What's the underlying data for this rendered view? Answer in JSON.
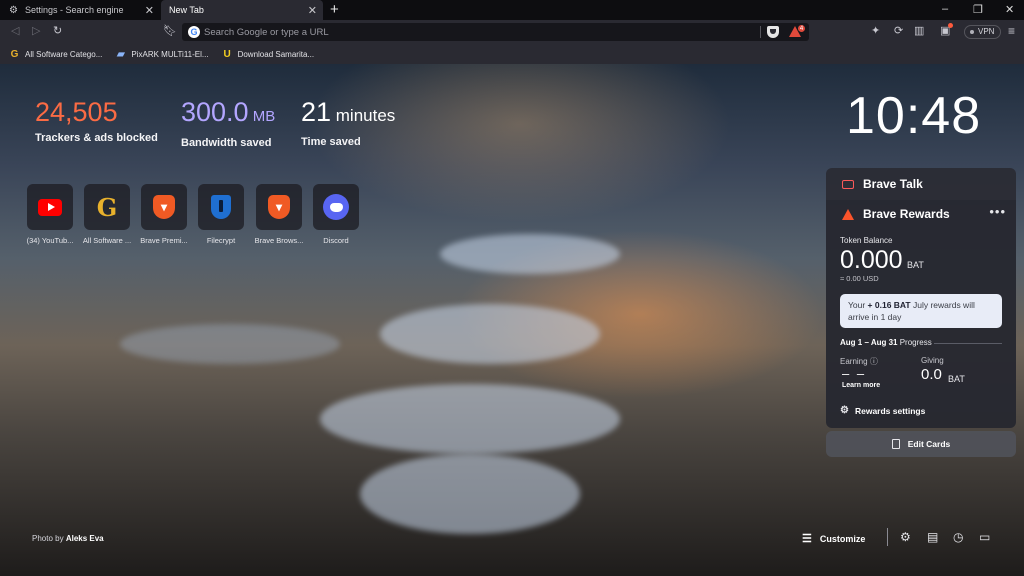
{
  "tabs": [
    {
      "title": "Settings - Search engine",
      "icon": "gear-icon"
    },
    {
      "title": "New Tab",
      "icon": "brave-icon"
    }
  ],
  "new_tab_symbol": "+",
  "window_controls": {
    "minimize": "–",
    "restore": "❐",
    "close": "✕"
  },
  "omnibox": {
    "placeholder": "Search Google or type a URL",
    "value": ""
  },
  "rewards_badge_count": "4",
  "vpn_label": "VPN",
  "bookmarks": [
    {
      "label": "All Software Catego...",
      "icon": "G",
      "color": "#e8b12c"
    },
    {
      "label": "PixARK MULTi11-El...",
      "icon": "▰",
      "color": "#8ab4f8"
    },
    {
      "label": "Download Samarita...",
      "icon": "U",
      "color": "#f5d020"
    }
  ],
  "stats": {
    "trackers": {
      "value": "24,505",
      "unit": "",
      "label": "Trackers & ads blocked",
      "color": "#fb6b44"
    },
    "bandwidth": {
      "value": "300.0",
      "unit": " MB",
      "label": "Bandwidth saved",
      "color": "#b3a6ff"
    },
    "time": {
      "value": "21",
      "unit": " minutes",
      "label": "Time saved",
      "color": "#ffffff"
    }
  },
  "clock": "10:48",
  "top_sites": [
    {
      "label": "(34) YouTub...",
      "icon": "youtube-icon"
    },
    {
      "label": "All Software ...",
      "icon": "g-icon"
    },
    {
      "label": "Brave Premi...",
      "icon": "brave-lion-icon"
    },
    {
      "label": "Filecrypt",
      "icon": "filecrypt-shield-icon"
    },
    {
      "label": "Brave Brows...",
      "icon": "brave-lion-icon"
    },
    {
      "label": "Discord",
      "icon": "discord-icon"
    }
  ],
  "brave_talk": {
    "title": "Brave Talk"
  },
  "rewards": {
    "title": "Brave Rewards",
    "more": "•••",
    "token_label": "Token Balance",
    "balance": "0.000",
    "balance_unit": "BAT",
    "usd": "≈ 0.00 USD",
    "note_prefix": "Your ",
    "note_amount": "+ 0.16 BAT",
    "note_suffix": " July rewards will arrive in 1 day",
    "range": "Aug 1 – Aug 31",
    "range_suffix": " Progress",
    "earning_label": "Earning",
    "earning_value": "– –",
    "learn_more": "Learn more",
    "giving_label": "Giving",
    "giving_value": "0.0",
    "giving_unit": "BAT",
    "settings_label": "Rewards settings"
  },
  "edit_cards_label": "Edit Cards",
  "photo_credit_prefix": "Photo by ",
  "photo_credit_author": "Aleks Eva",
  "customize_label": "Customize"
}
